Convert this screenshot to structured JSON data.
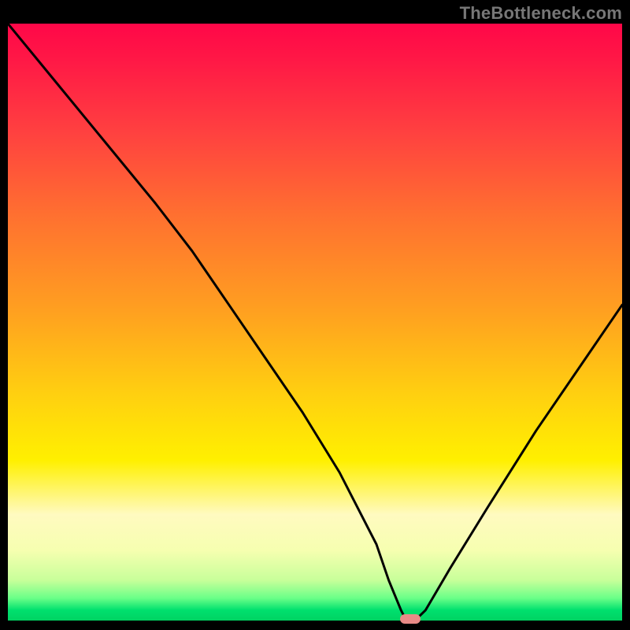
{
  "watermark": "TheBottleneck.com",
  "chart_data": {
    "type": "line",
    "title": "",
    "xlabel": "",
    "ylabel": "",
    "xlim": [
      0,
      100
    ],
    "ylim": [
      0,
      100
    ],
    "grid": false,
    "legend": false,
    "series": [
      {
        "name": "bottleneck-curve",
        "x": [
          0,
          8,
          16,
          24,
          30,
          36,
          42,
          48,
          54,
          60,
          62,
          64,
          65,
          66,
          68,
          72,
          78,
          86,
          94,
          100
        ],
        "values": [
          100,
          90,
          80,
          70,
          62,
          53,
          44,
          35,
          25,
          13,
          7,
          2,
          0,
          0,
          2,
          9,
          19,
          32,
          44,
          53
        ]
      }
    ],
    "marker": {
      "x": 65.5,
      "y": 0,
      "color": "#e98a87"
    },
    "gradient": {
      "top": "#ff0748",
      "mid_upper": "#ff7030",
      "mid": "#fff000",
      "mid_lower": "#c8ff9a",
      "bottom": "#00d060"
    }
  }
}
